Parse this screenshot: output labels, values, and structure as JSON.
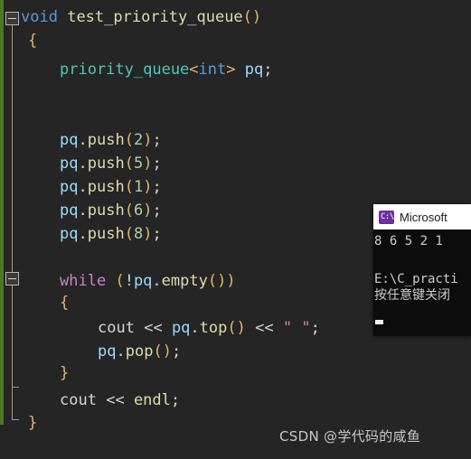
{
  "editor": {
    "background_color": "#252526",
    "change_strip_color": "#4b7a1e",
    "code_lines": [
      {
        "n": 1,
        "indent": 0,
        "text": "void test_priority_queue()"
      },
      {
        "n": 2,
        "indent": 0,
        "text": "{"
      },
      {
        "n": 3,
        "indent": 1,
        "text": "priority_queue<int> pq;"
      },
      {
        "n": 4,
        "indent": 1,
        "text": ""
      },
      {
        "n": 5,
        "indent": 1,
        "text": ""
      },
      {
        "n": 6,
        "indent": 1,
        "text": "pq.push(2);"
      },
      {
        "n": 7,
        "indent": 1,
        "text": "pq.push(5);"
      },
      {
        "n": 8,
        "indent": 1,
        "text": "pq.push(1);"
      },
      {
        "n": 9,
        "indent": 1,
        "text": "pq.push(6);"
      },
      {
        "n": 10,
        "indent": 1,
        "text": "pq.push(8);"
      },
      {
        "n": 11,
        "indent": 1,
        "text": ""
      },
      {
        "n": 12,
        "indent": 1,
        "text": "while (!pq.empty())"
      },
      {
        "n": 13,
        "indent": 1,
        "text": "{"
      },
      {
        "n": 14,
        "indent": 2,
        "text": "cout << pq.top() << \" \";"
      },
      {
        "n": 15,
        "indent": 2,
        "text": "pq.pop();"
      },
      {
        "n": 16,
        "indent": 1,
        "text": "}"
      },
      {
        "n": 17,
        "indent": 1,
        "text": "cout << endl;"
      },
      {
        "n": 18,
        "indent": 0,
        "text": "}"
      }
    ],
    "tokens": {
      "void": "void",
      "fn_name": "test_priority_queue",
      "paren_open": "(",
      "paren_close": ")",
      "brace_open": "{",
      "brace_close": "}",
      "type_priority_queue": "priority_queue",
      "angle_open": "<",
      "type_int": "int",
      "angle_close": ">",
      "var_pq": "pq",
      "semicolon": ";",
      "dot": ".",
      "m_push": "push",
      "m_empty": "empty",
      "m_top": "top",
      "m_pop": "pop",
      "kw_while": "while",
      "bang": "!",
      "cout": "cout",
      "shift": "<<",
      "space_string": "\" \"",
      "endl": "endl",
      "push_args": [
        "2",
        "5",
        "1",
        "6",
        "8"
      ]
    },
    "colors": {
      "keyword": "#569cd6",
      "control_keyword": "#c586c0",
      "function": "#dcdcaa",
      "type": "#4ec9b0",
      "variable": "#9cdcfe",
      "plain": "#d4d4d4",
      "number": "#b5cea8",
      "string": "#ce9178",
      "brace": "#dcb967"
    },
    "fold_markers": [
      {
        "name": "fold-function-body",
        "line": 1
      },
      {
        "name": "fold-while-body",
        "line": 12
      }
    ]
  },
  "console": {
    "title": "Microsoft ",
    "icon": "console-icon",
    "icon_glyph": "C:\\",
    "output_line": "8 6 5 2 1",
    "path_line": "E:\\C_practi",
    "prompt_line": "按任意键关闭",
    "background_color": "#0c0c0c",
    "titlebar_color": "#ffffff"
  },
  "watermark": {
    "text": "CSDN @学代码的咸鱼"
  }
}
